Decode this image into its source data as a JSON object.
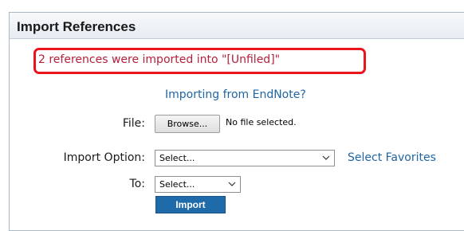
{
  "panel": {
    "title": "Import References",
    "status_message": "2 references were imported into \"[Unfiled]\"",
    "endnote_link": "Importing from EndNote?"
  },
  "form": {
    "file_label": "File:",
    "browse_label": "Browse...",
    "file_status": "No file selected.",
    "import_option_label": "Import Option:",
    "import_option_value": "Select...",
    "favorites_link": "Select Favorites",
    "to_label": "To:",
    "to_value": "Select...",
    "import_button": "Import"
  },
  "colors": {
    "status_text": "#b41f3a",
    "status_highlight_border": "#e8141e",
    "link": "#1f65a3",
    "import_button": "#1f6aa8"
  }
}
